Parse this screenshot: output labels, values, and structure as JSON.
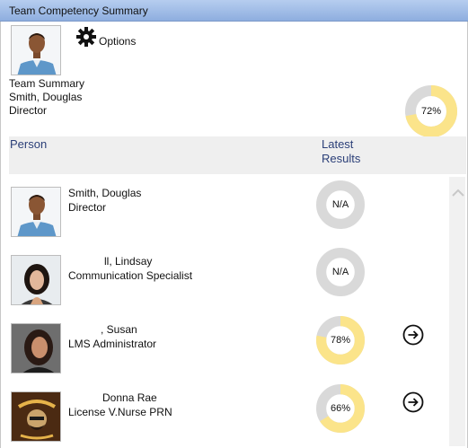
{
  "window": {
    "title": "Team Competency Summary"
  },
  "options": {
    "label": "Options",
    "icon": "gear-icon"
  },
  "summary": {
    "label": "Team Summary",
    "name": "Smith, Douglas",
    "role": "Director",
    "percent_text": "72%",
    "percent": 0.72
  },
  "columns": {
    "person": "Person",
    "latest_results": "Latest\nResults"
  },
  "colors": {
    "donut_fill": "#fbe48a",
    "donut_track": "#d9d9d9",
    "header_text": "#2b3f78",
    "titlebar": "#9db9e6"
  },
  "people": [
    {
      "name": "Smith, Douglas",
      "role": "Director",
      "result_text": "N/A",
      "percent": null,
      "has_arrow": false
    },
    {
      "name": "ll, Lindsay",
      "role": "Communication Specialist",
      "result_text": "N/A",
      "percent": null,
      "has_arrow": false
    },
    {
      "name": ", Susan",
      "role": "LMS Administrator",
      "result_text": "78%",
      "percent": 0.78,
      "has_arrow": true
    },
    {
      "name": "Donna Rae",
      "role": "License V.Nurse PRN",
      "result_text": "66%",
      "percent": 0.66,
      "has_arrow": true
    }
  ]
}
